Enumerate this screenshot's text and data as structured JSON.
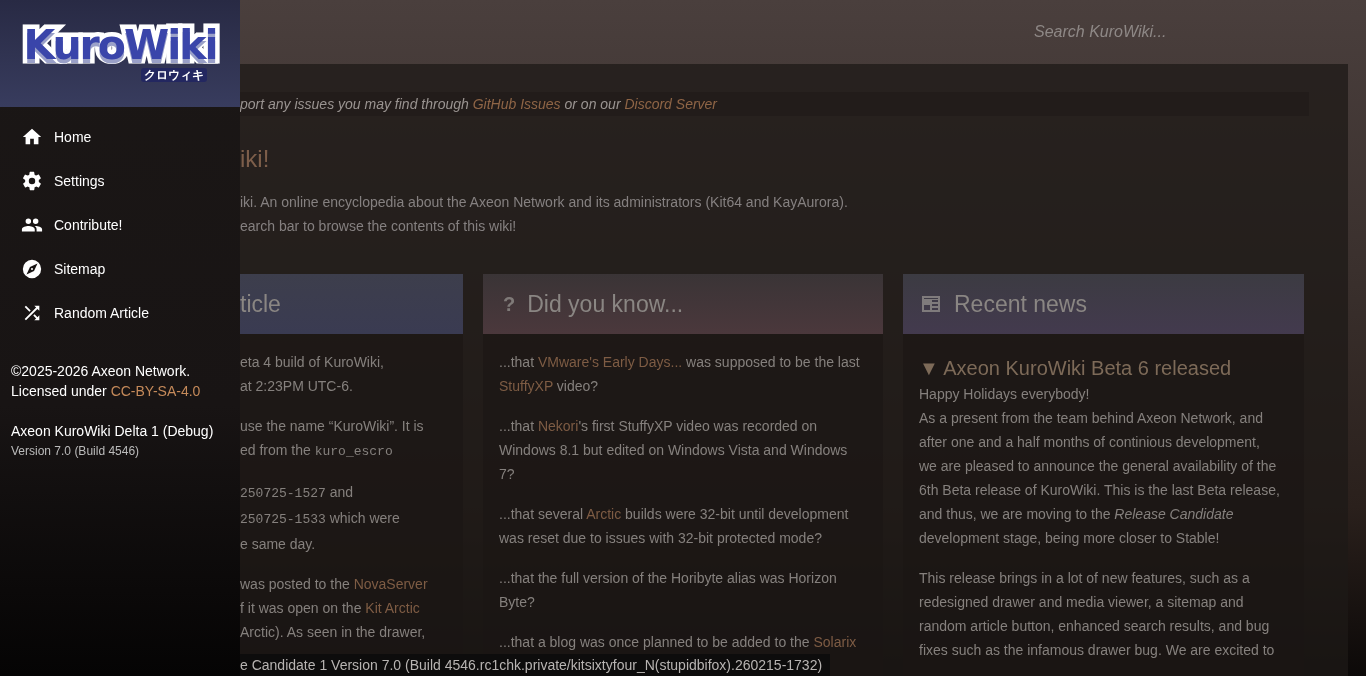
{
  "drawer": {
    "logo": {
      "text": "KuroWiki",
      "subtext": "クロウィキ"
    },
    "menu": [
      {
        "label": "Home"
      },
      {
        "label": "Settings"
      },
      {
        "label": "Contribute!"
      },
      {
        "label": "Sitemap"
      },
      {
        "label": "Random Article"
      }
    ],
    "copyright": "©2025-2026 Axeon Network.",
    "license": [
      {
        "kind": "text",
        "text": "Licensed under "
      },
      {
        "kind": "link",
        "text": "CC-BY-SA-4.0"
      }
    ],
    "build_name": "Axeon KuroWiki Delta 1 (Debug)",
    "build_version": "Version 7.0 (Build 4546)"
  },
  "search": {
    "placeholder": "Search KuroWiki..."
  },
  "notice": [
    {
      "kind": "text",
      "text": "port any issues you may find through "
    },
    {
      "kind": "link",
      "text": "GitHub Issues"
    },
    {
      "kind": "text",
      "text": " or on our "
    },
    {
      "kind": "link",
      "text": "Discord Server"
    }
  ],
  "title": "iki!",
  "intro": [
    "iki. An online encyclopedia about the Axeon Network and its administrators (Kit64 and KayAurora).",
    "earch bar to browse the contents of this wiki!"
  ],
  "cards": [
    {
      "title": "ticle",
      "paragraphs": [
        [
          "eta 4 build of KuroWiki,",
          "at 2:23PM UTC-6."
        ],
        [
          "use the name “KuroWiki”. It is",
          [
            {
              "kind": "text",
              "text": "ed from the "
            },
            {
              "kind": "code",
              "text": "kuro_escro"
            }
          ]
        ],
        [
          [
            {
              "kind": "code",
              "text": "250725-1527"
            },
            {
              "kind": "text",
              "text": " and"
            }
          ],
          [
            {
              "kind": "code",
              "text": "250725-1533"
            },
            {
              "kind": "text",
              "text": " which were"
            }
          ],
          "e same day."
        ],
        [
          [
            {
              "kind": "text",
              "text": "was posted to the "
            },
            {
              "kind": "link",
              "text": "NovaServer"
            }
          ],
          [
            {
              "kind": "text",
              "text": "f it was open on the "
            },
            {
              "kind": "link",
              "text": "Kit Arctic"
            }
          ],
          "Arctic). As seen in the drawer,"
        ]
      ]
    },
    {
      "title": "Did you know...",
      "icon": "?",
      "paragraphs": [
        [
          [
            {
              "kind": "text",
              "text": "...that "
            },
            {
              "kind": "link",
              "text": "VMware's Early Days..."
            },
            {
              "kind": "text",
              "text": " was supposed to be the last"
            }
          ],
          [
            {
              "kind": "link",
              "text": "StuffyXP"
            },
            {
              "kind": "text",
              "text": " video?"
            }
          ]
        ],
        [
          [
            {
              "kind": "text",
              "text": "...that "
            },
            {
              "kind": "link",
              "text": "Nekori"
            },
            {
              "kind": "text",
              "text": "'s first StuffyXP video was recorded on"
            }
          ],
          "Windows 8.1 but edited on Windows Vista and Windows",
          "7?"
        ],
        [
          [
            {
              "kind": "text",
              "text": "...that several "
            },
            {
              "kind": "link",
              "text": "Arctic"
            },
            {
              "kind": "text",
              "text": " builds were 32-bit until development"
            }
          ],
          "was reset due to issues with 32-bit protected mode?"
        ],
        [
          "...that the full version of the Horibyte alias was Horizon",
          "Byte?"
        ],
        [
          [
            {
              "kind": "text",
              "text": "...that a blog was once planned to be added to the "
            },
            {
              "kind": "link",
              "text": "Solarix"
            }
          ]
        ]
      ]
    },
    {
      "title": "Recent news",
      "article": {
        "marker": "▼",
        "heading": "Axeon KuroWiki Beta 6 released"
      },
      "paragraphs": [
        [
          "Happy Holidays everybody!",
          "As a present from the team behind Axeon Network, and",
          "after one and a half months of continious development,",
          "we are pleased to announce the general availability of the",
          "6th Beta release of KuroWiki. This is the last Beta release,",
          [
            {
              "kind": "text",
              "text": "and thus, we are moving to the "
            },
            {
              "kind": "em",
              "text": "Release Candidate"
            }
          ],
          "development stage, being more closer to Stable!"
        ],
        [
          "This release brings in a lot of new features, such as a",
          "redesigned drawer and media viewer, a sitemap and",
          "random article button, enhanced search results, and bug",
          "fixes such as the infamous drawer bug. We are excited to"
        ]
      ]
    }
  ],
  "status_bar": "e Candidate 1 Version 7.0 (Build 4546.rc1chk.private/kitsixtyfour_N(stupidbifox).260215-1732)"
}
